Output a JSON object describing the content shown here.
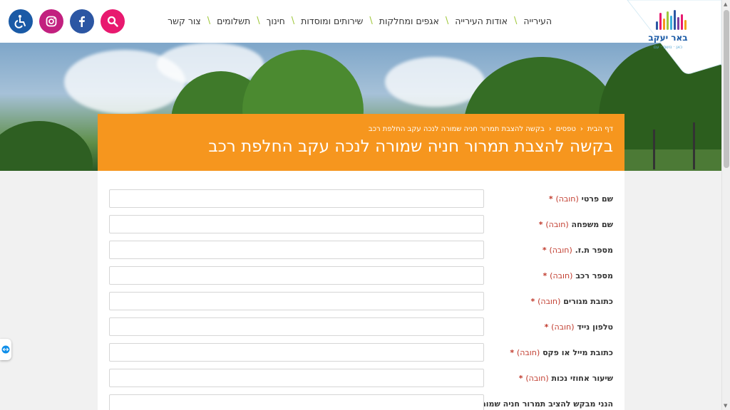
{
  "logo": {
    "name": "באר יעקב",
    "tagline": "כאן · נושם · עם"
  },
  "nav": {
    "items": [
      {
        "label": "העירייה"
      },
      {
        "label": "אודות העירייה"
      },
      {
        "label": "אגפים ומחלקות"
      },
      {
        "label": "שירותים ומוסדות"
      },
      {
        "label": "חינוך"
      },
      {
        "label": "תשלומים"
      },
      {
        "label": "צור קשר"
      }
    ]
  },
  "icons": {
    "accessibility": "accessibility-icon",
    "facebook": "facebook-icon",
    "instagram": "instagram-icon",
    "search": "search-icon"
  },
  "colors": {
    "accent_orange": "#f6961e",
    "nav_separator": "#a0c83c",
    "search": "#e8196f",
    "instagram": "#c2207f",
    "facebook": "#2c56a3",
    "accessibility": "#1a5aa6"
  },
  "breadcrumb": {
    "home": "דף הבית",
    "forms": "טפסים",
    "current": "בקשה להצבת תמרור חניה שמורה לנכה עקב החלפת רכב"
  },
  "page": {
    "title": "בקשה להצבת תמרור חניה שמורה לנכה עקב החלפת רכב"
  },
  "form": {
    "required_text": "(חובה)",
    "star": "*",
    "fields": [
      {
        "label": "שם פרטי",
        "value": ""
      },
      {
        "label": "שם משפחה",
        "value": ""
      },
      {
        "label": "מספר ת.ז.",
        "value": ""
      },
      {
        "label": "מספר רכב",
        "value": ""
      },
      {
        "label": "כתובת מגורים",
        "value": ""
      },
      {
        "label": "טלפון נייד",
        "value": ""
      },
      {
        "label": "כתובת מייל או פקס",
        "value": ""
      },
      {
        "label": "שיעור אחוזי נכות",
        "value": ""
      }
    ],
    "last_label": "הנני מבקש להציב תמרור חניה שמורה"
  }
}
